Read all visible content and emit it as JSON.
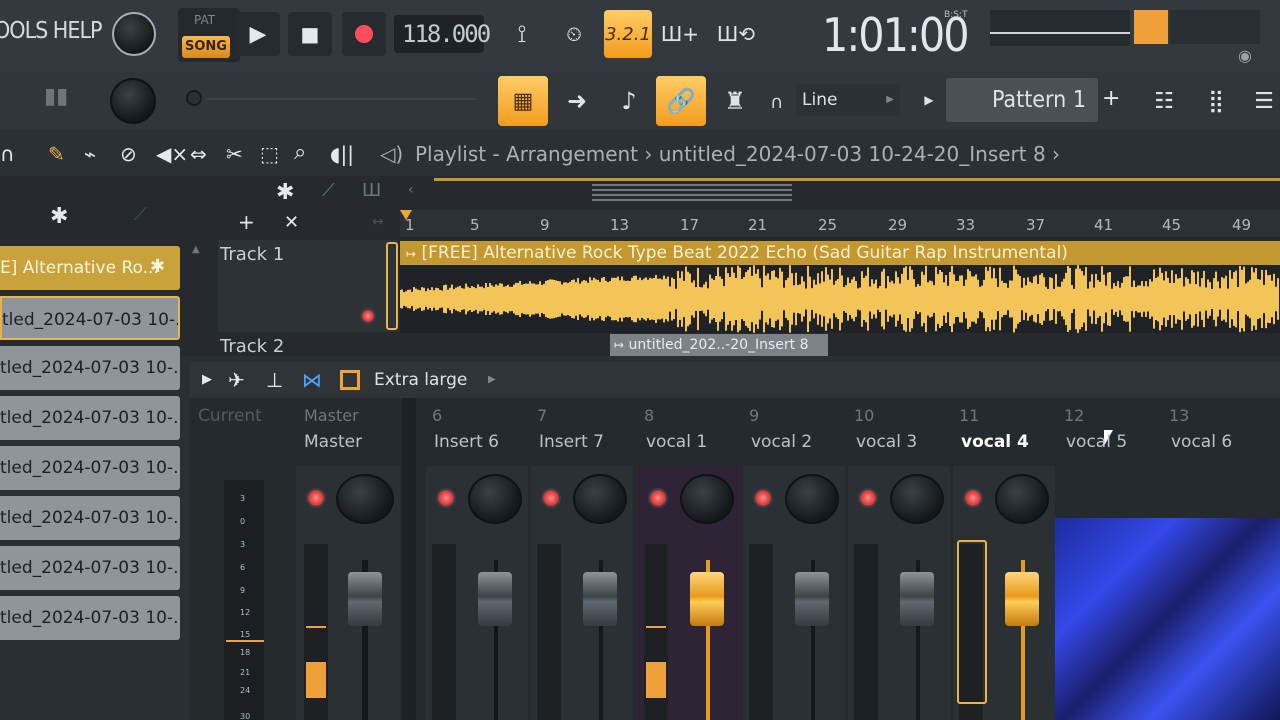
{
  "menu": "OOLS HELP",
  "transport": {
    "pat": "PAT",
    "song": "SONG",
    "tempo": "118.000"
  },
  "snap_display": "3.2.1",
  "time": {
    "value": "1:01:00",
    "unit": "B:S:T"
  },
  "snap_mode": "Line",
  "pattern": "Pattern 1",
  "breadcrumb": "Playlist - Arrangement › untitled_2024-07-03 10-24-20_Insert 8 ›",
  "ruler_ticks": [
    "1",
    "5",
    "9",
    "13",
    "17",
    "21",
    "25",
    "29",
    "33",
    "37",
    "41",
    "45",
    "49"
  ],
  "tracks": [
    "Track 1",
    "Track 2"
  ],
  "clips": {
    "clip1": "[FREE] Alternative Rock Type Beat 2022 Echo (Sad Guitar Rap Instrumental)",
    "clip2": "untitled_202..-20_Insert 8"
  },
  "pattern_list": [
    "E] Alternative Ro...",
    "tled_2024-07-03 10-...",
    "tled_2024-07-03 10-...",
    "tled_2024-07-03 10-...",
    "tled_2024-07-03 10-...",
    "tled_2024-07-03 10-...",
    "tled_2024-07-03 10-...",
    "tled_2024-07-03 10-..."
  ],
  "mixer": {
    "view_size": "Extra large",
    "current_label": "Current",
    "master_num": "Master",
    "master_name": "Master",
    "channels": [
      {
        "num": "6",
        "name": "Insert 6"
      },
      {
        "num": "7",
        "name": "Insert 7"
      },
      {
        "num": "8",
        "name": "vocal 1"
      },
      {
        "num": "9",
        "name": "vocal 2"
      },
      {
        "num": "10",
        "name": "vocal 3"
      },
      {
        "num": "11",
        "name": "vocal 4"
      },
      {
        "num": "12",
        "name": "vocal 5"
      },
      {
        "num": "13",
        "name": "vocal 6"
      }
    ],
    "meter_scale": [
      "3",
      "0",
      "3",
      "6",
      "9",
      "12",
      "15",
      "18",
      "21",
      "24",
      "30"
    ]
  },
  "colors": {
    "accent": "#f39c1e",
    "clip": "#c49830",
    "waveform": "#f3c558"
  }
}
